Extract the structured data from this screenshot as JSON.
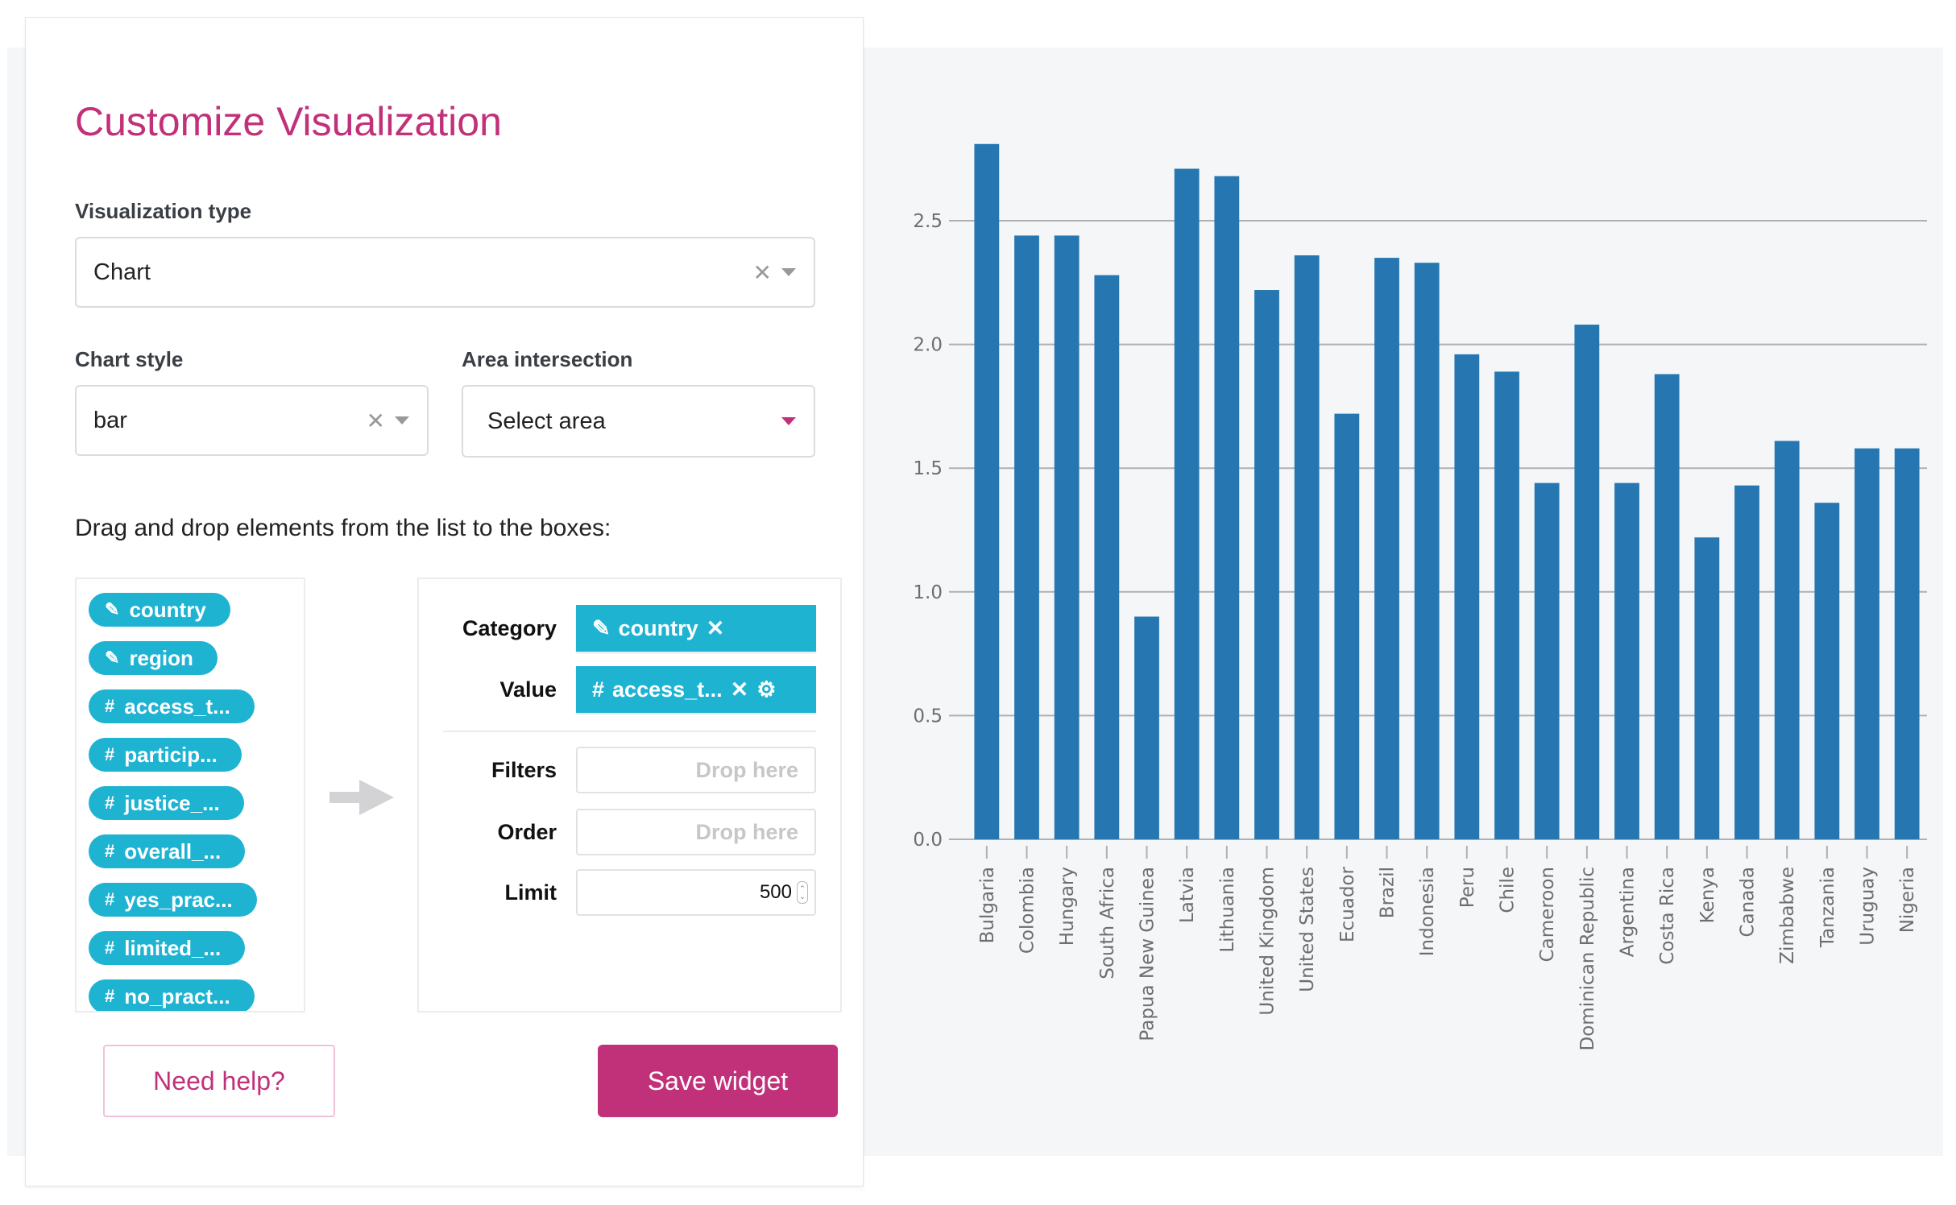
{
  "panel": {
    "title": "Customize Visualization",
    "visualization_type": {
      "label": "Visualization type",
      "value": "Chart"
    },
    "chart_style": {
      "label": "Chart style",
      "value": "bar"
    },
    "area_intersection": {
      "label": "Area intersection",
      "placeholder": "Select area"
    },
    "instructions": "Drag and drop elements from the list to the boxes:",
    "fields": [
      {
        "type": "category",
        "icon": "tag-icon",
        "label": "country"
      },
      {
        "type": "category",
        "icon": "tag-icon",
        "label": "region"
      },
      {
        "type": "number",
        "icon": "hash-icon",
        "label": "access_t..."
      },
      {
        "type": "number",
        "icon": "hash-icon",
        "label": "particip..."
      },
      {
        "type": "number",
        "icon": "hash-icon",
        "label": "justice_..."
      },
      {
        "type": "number",
        "icon": "hash-icon",
        "label": "overall_..."
      },
      {
        "type": "number",
        "icon": "hash-icon",
        "label": "yes_prac..."
      },
      {
        "type": "number",
        "icon": "hash-icon",
        "label": "limited_..."
      },
      {
        "type": "number",
        "icon": "hash-icon",
        "label": "no_pract..."
      }
    ],
    "boxes": {
      "category": {
        "label": "Category",
        "value": "country"
      },
      "value": {
        "label": "Value",
        "value": "access_t..."
      },
      "filters": {
        "label": "Filters",
        "placeholder": "Drop here"
      },
      "order": {
        "label": "Order",
        "placeholder": "Drop here"
      },
      "limit": {
        "label": "Limit",
        "value": "500"
      }
    },
    "help_button": "Need help?",
    "save_button": "Save widget"
  },
  "icons": {
    "tag": "✎",
    "hash": "#",
    "close": "✕",
    "gear": "⚙"
  },
  "colors": {
    "accent": "#c1317a",
    "field": "#1fb3d2",
    "bar": "#2677b1",
    "chart_bg": "#f4f6f8"
  },
  "chart_data": {
    "type": "bar",
    "title": "",
    "xlabel": "",
    "ylabel": "",
    "ylim": [
      0,
      2.85
    ],
    "yticks": [
      "0.0",
      "0.5",
      "1.0",
      "1.5",
      "2.0",
      "2.5"
    ],
    "grid": true,
    "categories": [
      "Bulgaria",
      "Colombia",
      "Hungary",
      "South Africa",
      "Papua New Guinea",
      "Latvia",
      "Lithuania",
      "United Kingdom",
      "United States",
      "Ecuador",
      "Brazil",
      "Indonesia",
      "Peru",
      "Chile",
      "Cameroon",
      "Dominican Republic",
      "Argentina",
      "Costa Rica",
      "Kenya",
      "Canada",
      "Zimbabwe",
      "Tanzania",
      "Uruguay",
      "Nigeria"
    ],
    "values": [
      2.81,
      2.44,
      2.44,
      2.28,
      0.9,
      2.71,
      2.68,
      2.22,
      2.36,
      1.72,
      2.35,
      2.33,
      1.96,
      1.89,
      1.44,
      2.08,
      1.44,
      1.88,
      1.22,
      1.43,
      1.61,
      1.36,
      1.58,
      1.58
    ]
  }
}
